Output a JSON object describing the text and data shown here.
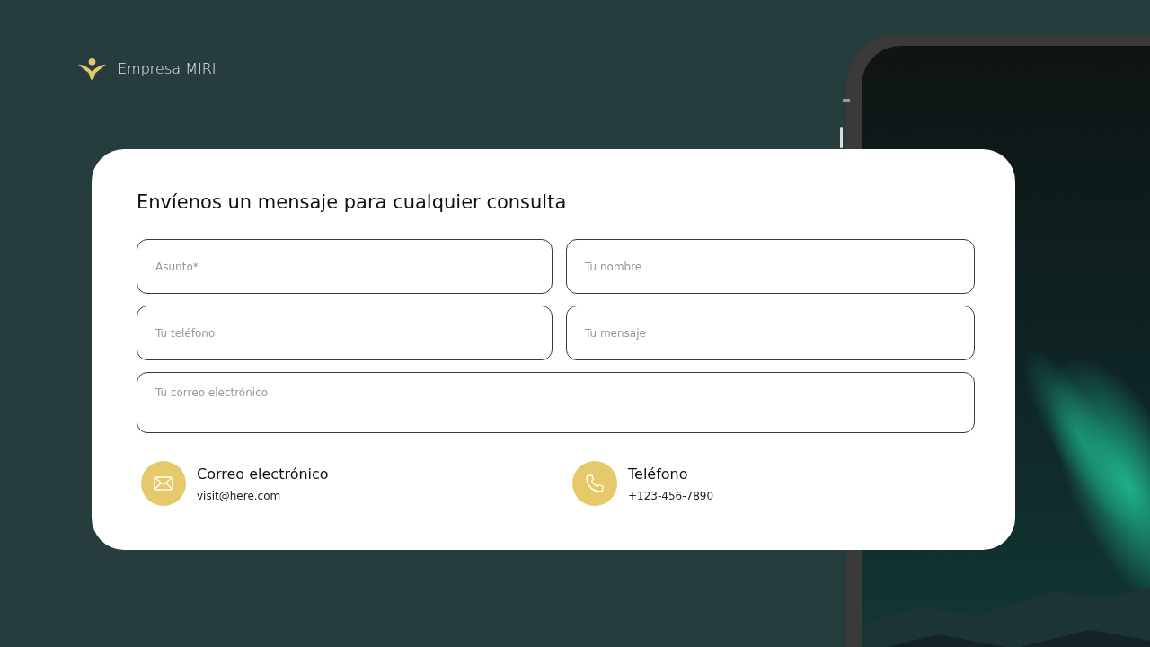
{
  "brand": {
    "name": "Empresa MIRI"
  },
  "form": {
    "title": "Envíenos un mensaje para cualquier consulta",
    "fields": [
      {
        "placeholder": "Asunto*",
        "kind": "input"
      },
      {
        "placeholder": "Tu nombre",
        "kind": "input"
      },
      {
        "placeholder": "Tu teléfono",
        "kind": "input"
      },
      {
        "placeholder": "Tu mensaje",
        "kind": "input"
      },
      {
        "placeholder": "Tu correo electrónico",
        "kind": "textarea"
      }
    ]
  },
  "contacts": [
    {
      "kind": "email",
      "label": "Correo electrónico",
      "value": "visit@here.com"
    },
    {
      "kind": "phone",
      "label": "Teléfono",
      "value": "+123-456-7890"
    }
  ]
}
